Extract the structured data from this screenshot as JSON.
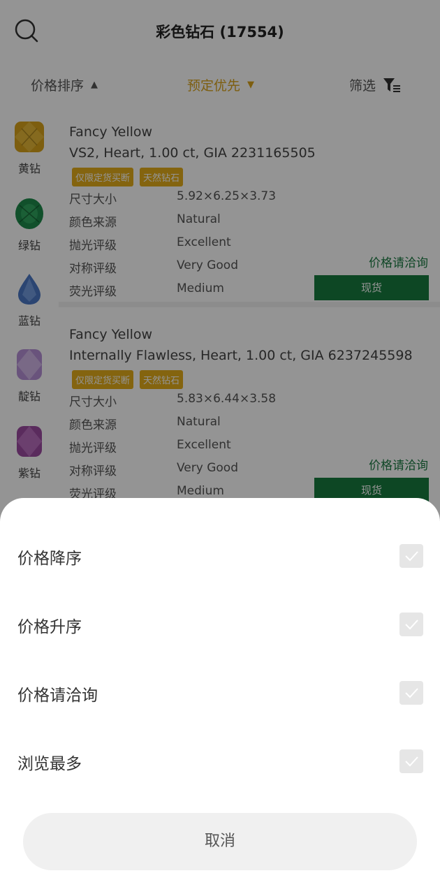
{
  "header": {
    "title": "彩色钻石 (17554)"
  },
  "sortbar": {
    "price_sort": "价格排序",
    "presale_first": "预定优先",
    "filter": "筛选"
  },
  "categories": [
    {
      "label": "黄钻",
      "color": "#d8a21b"
    },
    {
      "label": "绿钻",
      "color": "#1e8a4a"
    },
    {
      "label": "蓝钻",
      "color": "#4a78c4"
    },
    {
      "label": "靛钻",
      "color": "#b58fd6"
    },
    {
      "label": "紫钻",
      "color": "#9b4aa0"
    }
  ],
  "listings": [
    {
      "title": "Fancy Yellow",
      "subtitle": "VS2, Heart, 1.00 ct, GIA 2231165505",
      "badges": [
        "仅限定货买断",
        "天然钻石"
      ],
      "specs": [
        {
          "label": "尺寸大小",
          "value": "5.92×6.25×3.73"
        },
        {
          "label": "颜色来源",
          "value": "Natural"
        },
        {
          "label": "抛光评级",
          "value": "Excellent"
        },
        {
          "label": "对称评级",
          "value": "Very Good"
        },
        {
          "label": "荧光评级",
          "value": "Medium"
        }
      ],
      "price": "价格请洽询",
      "stock": "现货"
    },
    {
      "title": "Fancy Yellow",
      "subtitle": "Internally Flawless, Heart, 1.00 ct, GIA 6237245598",
      "badges": [
        "仅限定货买断",
        "天然钻石"
      ],
      "specs": [
        {
          "label": "尺寸大小",
          "value": "5.83×6.44×3.58"
        },
        {
          "label": "颜色来源",
          "value": "Natural"
        },
        {
          "label": "抛光评级",
          "value": "Excellent"
        },
        {
          "label": "对称评级",
          "value": "Very Good"
        },
        {
          "label": "荧光评级",
          "value": "Medium"
        }
      ],
      "price": "价格请洽询",
      "stock": "现货"
    }
  ],
  "sheet": {
    "options": [
      {
        "label": "价格降序"
      },
      {
        "label": "价格升序"
      },
      {
        "label": "价格请洽询"
      },
      {
        "label": "浏览最多"
      }
    ],
    "cancel": "取消"
  },
  "colors": {
    "accent_gold": "#d8a21b",
    "accent_green": "#177a3e"
  }
}
